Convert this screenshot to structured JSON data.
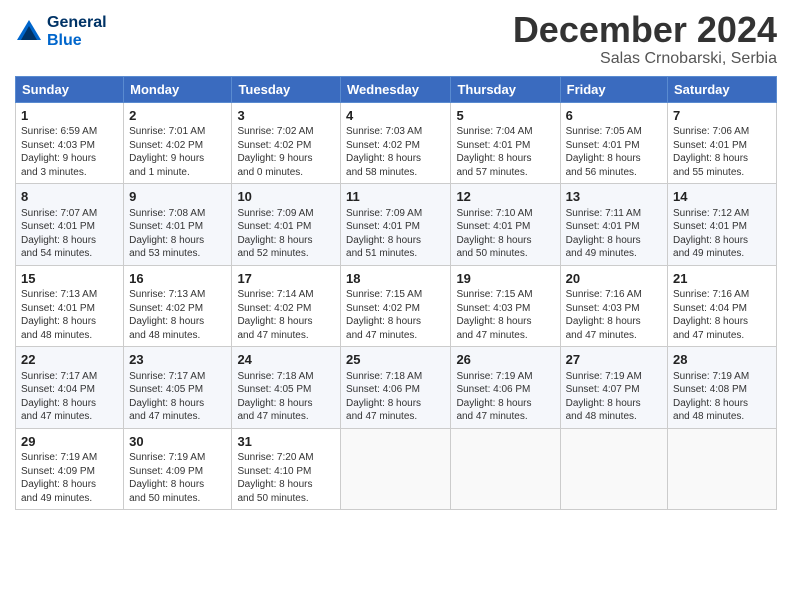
{
  "logo": {
    "line1": "General",
    "line2": "Blue"
  },
  "title": "December 2024",
  "subtitle": "Salas Crnobarski, Serbia",
  "days_of_week": [
    "Sunday",
    "Monday",
    "Tuesday",
    "Wednesday",
    "Thursday",
    "Friday",
    "Saturday"
  ],
  "weeks": [
    [
      {
        "day": "1",
        "info": "Sunrise: 6:59 AM\nSunset: 4:03 PM\nDaylight: 9 hours\nand 3 minutes."
      },
      {
        "day": "2",
        "info": "Sunrise: 7:01 AM\nSunset: 4:02 PM\nDaylight: 9 hours\nand 1 minute."
      },
      {
        "day": "3",
        "info": "Sunrise: 7:02 AM\nSunset: 4:02 PM\nDaylight: 9 hours\nand 0 minutes."
      },
      {
        "day": "4",
        "info": "Sunrise: 7:03 AM\nSunset: 4:02 PM\nDaylight: 8 hours\nand 58 minutes."
      },
      {
        "day": "5",
        "info": "Sunrise: 7:04 AM\nSunset: 4:01 PM\nDaylight: 8 hours\nand 57 minutes."
      },
      {
        "day": "6",
        "info": "Sunrise: 7:05 AM\nSunset: 4:01 PM\nDaylight: 8 hours\nand 56 minutes."
      },
      {
        "day": "7",
        "info": "Sunrise: 7:06 AM\nSunset: 4:01 PM\nDaylight: 8 hours\nand 55 minutes."
      }
    ],
    [
      {
        "day": "8",
        "info": "Sunrise: 7:07 AM\nSunset: 4:01 PM\nDaylight: 8 hours\nand 54 minutes."
      },
      {
        "day": "9",
        "info": "Sunrise: 7:08 AM\nSunset: 4:01 PM\nDaylight: 8 hours\nand 53 minutes."
      },
      {
        "day": "10",
        "info": "Sunrise: 7:09 AM\nSunset: 4:01 PM\nDaylight: 8 hours\nand 52 minutes."
      },
      {
        "day": "11",
        "info": "Sunrise: 7:09 AM\nSunset: 4:01 PM\nDaylight: 8 hours\nand 51 minutes."
      },
      {
        "day": "12",
        "info": "Sunrise: 7:10 AM\nSunset: 4:01 PM\nDaylight: 8 hours\nand 50 minutes."
      },
      {
        "day": "13",
        "info": "Sunrise: 7:11 AM\nSunset: 4:01 PM\nDaylight: 8 hours\nand 49 minutes."
      },
      {
        "day": "14",
        "info": "Sunrise: 7:12 AM\nSunset: 4:01 PM\nDaylight: 8 hours\nand 49 minutes."
      }
    ],
    [
      {
        "day": "15",
        "info": "Sunrise: 7:13 AM\nSunset: 4:01 PM\nDaylight: 8 hours\nand 48 minutes."
      },
      {
        "day": "16",
        "info": "Sunrise: 7:13 AM\nSunset: 4:02 PM\nDaylight: 8 hours\nand 48 minutes."
      },
      {
        "day": "17",
        "info": "Sunrise: 7:14 AM\nSunset: 4:02 PM\nDaylight: 8 hours\nand 47 minutes."
      },
      {
        "day": "18",
        "info": "Sunrise: 7:15 AM\nSunset: 4:02 PM\nDaylight: 8 hours\nand 47 minutes."
      },
      {
        "day": "19",
        "info": "Sunrise: 7:15 AM\nSunset: 4:03 PM\nDaylight: 8 hours\nand 47 minutes."
      },
      {
        "day": "20",
        "info": "Sunrise: 7:16 AM\nSunset: 4:03 PM\nDaylight: 8 hours\nand 47 minutes."
      },
      {
        "day": "21",
        "info": "Sunrise: 7:16 AM\nSunset: 4:04 PM\nDaylight: 8 hours\nand 47 minutes."
      }
    ],
    [
      {
        "day": "22",
        "info": "Sunrise: 7:17 AM\nSunset: 4:04 PM\nDaylight: 8 hours\nand 47 minutes."
      },
      {
        "day": "23",
        "info": "Sunrise: 7:17 AM\nSunset: 4:05 PM\nDaylight: 8 hours\nand 47 minutes."
      },
      {
        "day": "24",
        "info": "Sunrise: 7:18 AM\nSunset: 4:05 PM\nDaylight: 8 hours\nand 47 minutes."
      },
      {
        "day": "25",
        "info": "Sunrise: 7:18 AM\nSunset: 4:06 PM\nDaylight: 8 hours\nand 47 minutes."
      },
      {
        "day": "26",
        "info": "Sunrise: 7:19 AM\nSunset: 4:06 PM\nDaylight: 8 hours\nand 47 minutes."
      },
      {
        "day": "27",
        "info": "Sunrise: 7:19 AM\nSunset: 4:07 PM\nDaylight: 8 hours\nand 48 minutes."
      },
      {
        "day": "28",
        "info": "Sunrise: 7:19 AM\nSunset: 4:08 PM\nDaylight: 8 hours\nand 48 minutes."
      }
    ],
    [
      {
        "day": "29",
        "info": "Sunrise: 7:19 AM\nSunset: 4:09 PM\nDaylight: 8 hours\nand 49 minutes."
      },
      {
        "day": "30",
        "info": "Sunrise: 7:19 AM\nSunset: 4:09 PM\nDaylight: 8 hours\nand 50 minutes."
      },
      {
        "day": "31",
        "info": "Sunrise: 7:20 AM\nSunset: 4:10 PM\nDaylight: 8 hours\nand 50 minutes."
      },
      {
        "day": "",
        "info": ""
      },
      {
        "day": "",
        "info": ""
      },
      {
        "day": "",
        "info": ""
      },
      {
        "day": "",
        "info": ""
      }
    ]
  ]
}
